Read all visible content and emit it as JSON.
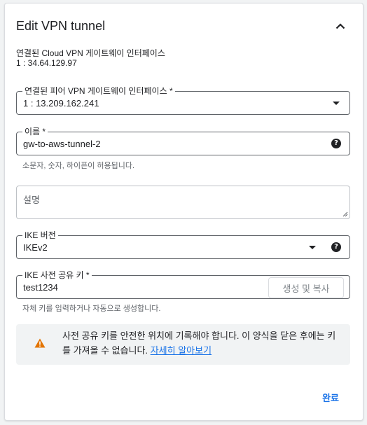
{
  "panel": {
    "title": "Edit VPN tunnel"
  },
  "cloud_gateway": {
    "label": "연결된 Cloud VPN 게이트웨이 인터페이스",
    "value": "1 : 34.64.129.97"
  },
  "peer_gateway": {
    "label": "연결된 피어 VPN 게이트웨이 인터페이스 *",
    "value": "1 : 13.209.162.241"
  },
  "name_field": {
    "label": "이름 *",
    "value": "gw-to-aws-tunnel-2",
    "hint": "소문자, 숫자, 하이픈이 허용됩니다."
  },
  "description": {
    "placeholder": "설명"
  },
  "ike_version": {
    "label": "IKE 버전",
    "value": "IKEv2"
  },
  "ike_key": {
    "label": "IKE 사전 공유 키 *",
    "value": "test1234",
    "generate_label": "생성 및 복사",
    "hint": "자체 키를 입력하거나 자동으로 생성합니다."
  },
  "warning": {
    "text": "사전 공유 키를 안전한 위치에 기록해야 합니다. 이 양식을 닫은 후에는 키를 가져올 수 없습니다. ",
    "link": "자세히 알아보기",
    "icon_color": "#e37400"
  },
  "actions": {
    "done_label": "완료"
  },
  "colors": {
    "accent": "#1a73e8",
    "border": "#5f6368"
  }
}
